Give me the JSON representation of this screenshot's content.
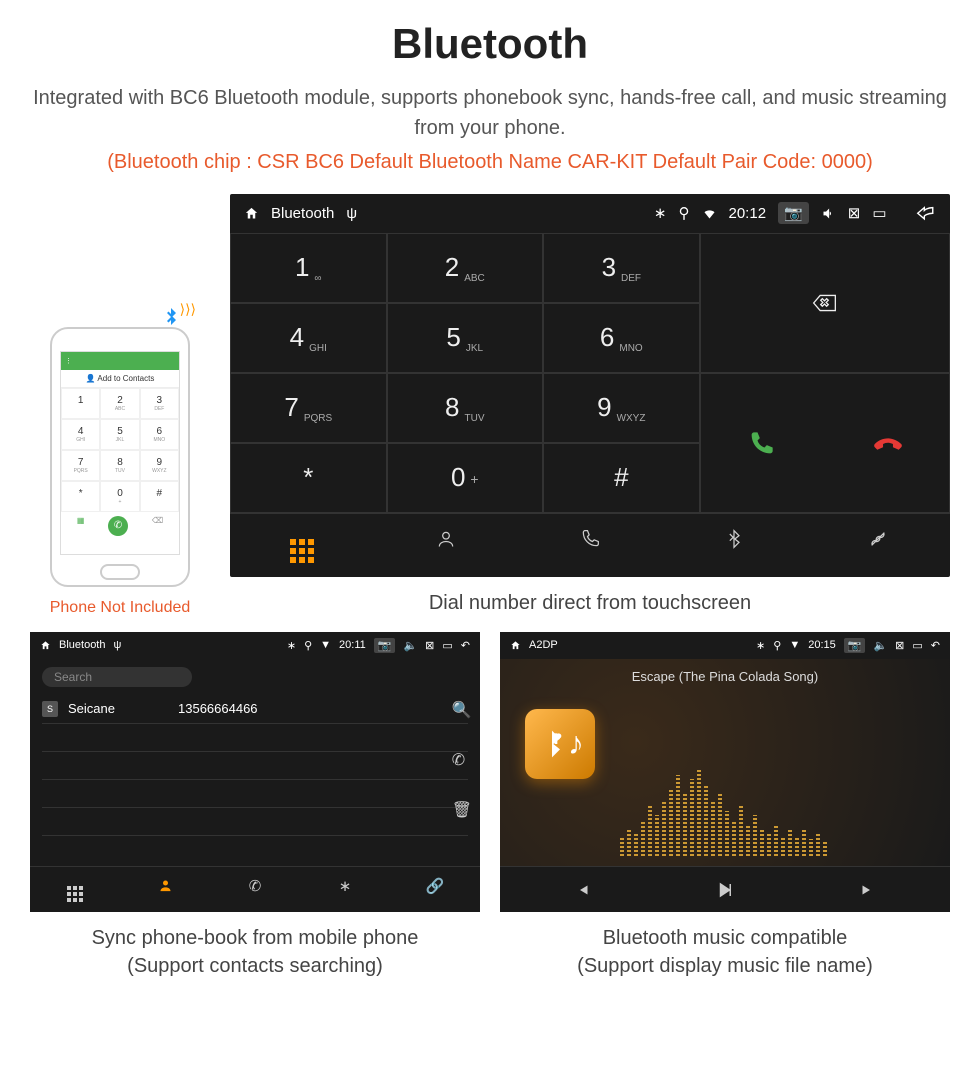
{
  "title": "Bluetooth",
  "subtitle": "Integrated with BC6 Bluetooth module, supports phonebook sync, hands-free call, and music streaming from your phone.",
  "spec_line": "(Bluetooth chip : CSR BC6    Default Bluetooth Name CAR-KIT    Default Pair Code: 0000)",
  "phone_caption": "Phone Not Included",
  "phone_add_label": "Add to Contacts",
  "dialer": {
    "app_name": "Bluetooth",
    "time": "20:12",
    "keys": [
      {
        "n": "1",
        "s": "∞"
      },
      {
        "n": "2",
        "s": "ABC"
      },
      {
        "n": "3",
        "s": "DEF"
      },
      {
        "n": "4",
        "s": "GHI"
      },
      {
        "n": "5",
        "s": "JKL"
      },
      {
        "n": "6",
        "s": "MNO"
      },
      {
        "n": "7",
        "s": "PQRS"
      },
      {
        "n": "8",
        "s": "TUV"
      },
      {
        "n": "9",
        "s": "WXYZ"
      },
      {
        "n": "*",
        "s": ""
      },
      {
        "n": "0",
        "s": "+"
      },
      {
        "n": "#",
        "s": ""
      }
    ],
    "caption": "Dial number direct from touchscreen"
  },
  "phonebook": {
    "app_name": "Bluetooth",
    "time": "20:11",
    "search_placeholder": "Search",
    "contact_initial": "S",
    "contact_name": "Seicane",
    "contact_number": "13566664466",
    "caption_l1": "Sync phone-book from mobile phone",
    "caption_l2": "(Support contacts searching)"
  },
  "music": {
    "app_name": "A2DP",
    "time": "20:15",
    "track": "Escape (The Pina Colada Song)",
    "caption_l1": "Bluetooth music compatible",
    "caption_l2": "(Support display music file name)"
  }
}
